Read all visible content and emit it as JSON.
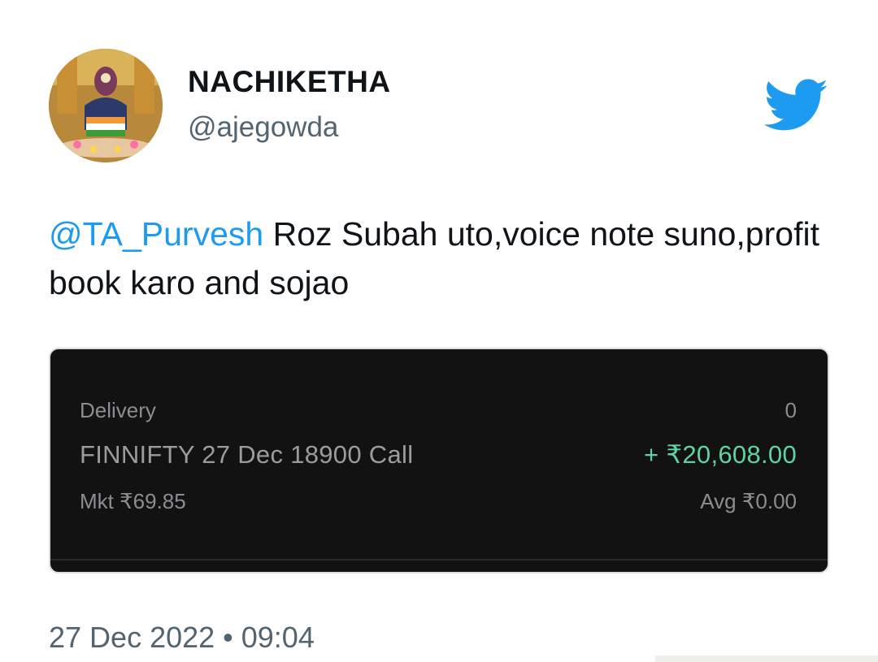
{
  "author": {
    "name": "NACHIKETHA",
    "handle": "@ajegowda"
  },
  "icons": {
    "logo": "twitter-bird-icon",
    "avatar": "profile-photo"
  },
  "tweet": {
    "mention": "@TA_Purvesh",
    "body": " Roz Subah  uto,voice note suno,profit book karo and sojao"
  },
  "position_card": {
    "segment_label": "Delivery",
    "quantity": "0",
    "instrument": "FINNIFTY 27 Dec 18900 Call",
    "pnl": "+ ₹20,608.00",
    "market_price": "Mkt ₹69.85",
    "average_price": "Avg ₹0.00"
  },
  "timestamp": "27 Dec 2022 • 09:04",
  "colors": {
    "link": "#1d9bf0",
    "profit_green": "#5fd3a0",
    "card_bg": "#121212",
    "secondary_text": "#536471"
  }
}
